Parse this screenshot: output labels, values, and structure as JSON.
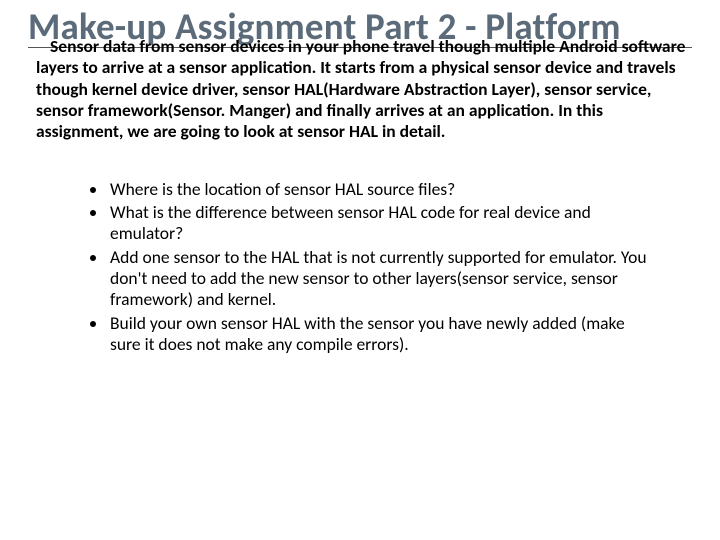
{
  "title": "Make-up Assignment Part 2 - Platform",
  "intro": "Sensor data from sensor devices in your phone travel though multiple Android software layers to arrive at a sensor application. It starts from a physical sensor device and travels though kernel device driver, sensor HAL(Hardware Abstraction Layer), sensor service, sensor framework(Sensor. Manger) and finally arrives at an application. In this assignment, we are going to look at sensor HAL in detail.",
  "bullets": [
    "Where is the location of sensor HAL source files?",
    "What is the difference between sensor HAL code for real device and emulator?",
    "Add one sensor to the HAL that is not currently supported for emulator. You don't need to add the new sensor to other layers(sensor service, sensor framework) and kernel.",
    "Build your own sensor HAL with the sensor you have newly added (make sure it does not make any compile errors)."
  ]
}
